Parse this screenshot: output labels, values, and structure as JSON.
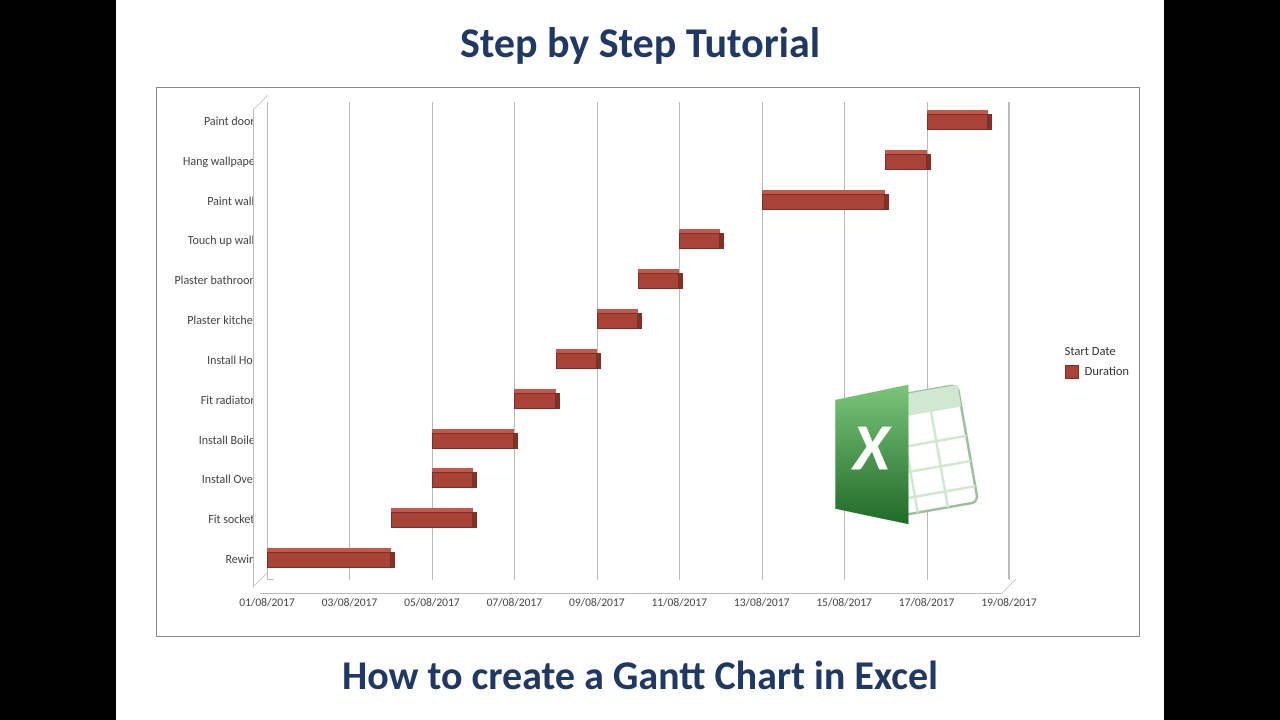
{
  "title": "Step by Step Tutorial",
  "subtitle": "How to create a Gantt Chart in Excel",
  "legend": {
    "series1": "Start Date",
    "series2": "Duration"
  },
  "chart_data": {
    "type": "bar",
    "orientation": "horizontal-gantt",
    "x_axis": {
      "label": "",
      "unit": "date",
      "format": "DD/MM/YYYY",
      "min": "01/08/2017",
      "max": "19/08/2017",
      "ticks": [
        "01/08/2017",
        "03/08/2017",
        "05/08/2017",
        "07/08/2017",
        "09/08/2017",
        "11/08/2017",
        "13/08/2017",
        "15/08/2017",
        "17/08/2017",
        "19/08/2017"
      ]
    },
    "y_axis": {
      "label": "",
      "categories": [
        "Rewire",
        "Fit sockets",
        "Install Oven",
        "Install Boiler",
        "Fit radiators",
        "Install Hob",
        "Plaster kitchen",
        "Plaster bathroom",
        "Touch up walls",
        "Paint walls",
        "Hang wallpaper",
        "Paint doors"
      ]
    },
    "series": [
      {
        "name": "Start Date",
        "role": "offset",
        "values": [
          "01/08/2017",
          "04/08/2017",
          "05/08/2017",
          "05/08/2017",
          "07/08/2017",
          "08/08/2017",
          "09/08/2017",
          "10/08/2017",
          "11/08/2017",
          "13/08/2017",
          "16/08/2017",
          "17/08/2017"
        ]
      },
      {
        "name": "Duration",
        "role": "length",
        "unit": "days",
        "values": [
          3,
          2,
          1,
          2,
          1,
          1,
          1,
          1,
          1,
          3,
          1,
          1.5
        ]
      }
    ],
    "tasks": [
      {
        "task": "Rewire",
        "start": "01/08/2017",
        "duration_days": 3
      },
      {
        "task": "Fit sockets",
        "start": "04/08/2017",
        "duration_days": 2
      },
      {
        "task": "Install Oven",
        "start": "05/08/2017",
        "duration_days": 1
      },
      {
        "task": "Install Boiler",
        "start": "05/08/2017",
        "duration_days": 2
      },
      {
        "task": "Fit radiators",
        "start": "07/08/2017",
        "duration_days": 1
      },
      {
        "task": "Install Hob",
        "start": "08/08/2017",
        "duration_days": 1
      },
      {
        "task": "Plaster kitchen",
        "start": "09/08/2017",
        "duration_days": 1
      },
      {
        "task": "Plaster bathroom",
        "start": "10/08/2017",
        "duration_days": 1
      },
      {
        "task": "Touch up walls",
        "start": "11/08/2017",
        "duration_days": 1
      },
      {
        "task": "Paint walls",
        "start": "13/08/2017",
        "duration_days": 3
      },
      {
        "task": "Hang wallpaper",
        "start": "16/08/2017",
        "duration_days": 1
      },
      {
        "task": "Paint doors",
        "start": "17/08/2017",
        "duration_days": 1.5
      }
    ],
    "style": {
      "bar_color": "#a94338",
      "three_d": true,
      "gridlines": "vertical"
    }
  }
}
